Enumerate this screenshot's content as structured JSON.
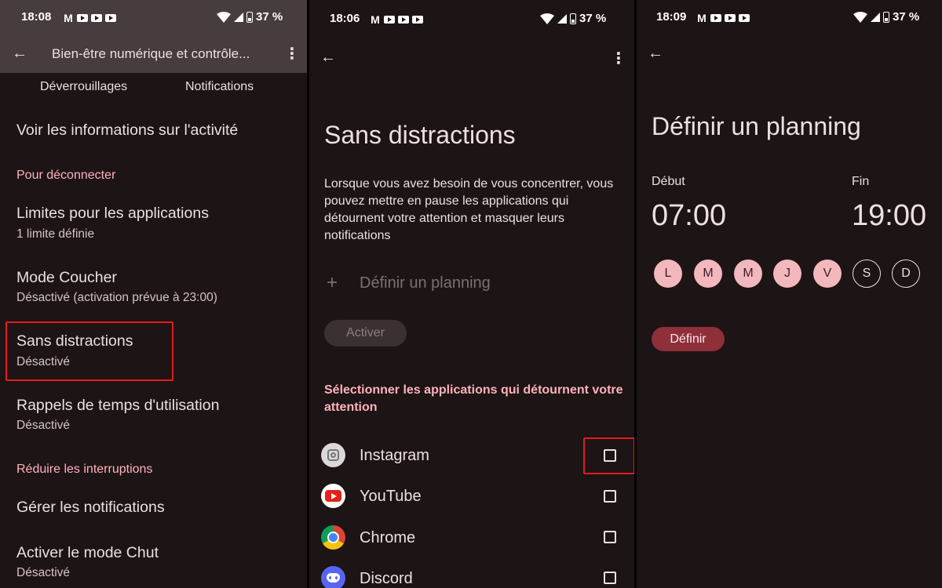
{
  "status_bars": [
    {
      "time": "18:08",
      "battery": "37 %"
    },
    {
      "time": "18:06",
      "battery": "37 %"
    },
    {
      "time": "18:09",
      "battery": "37 %"
    }
  ],
  "panel1": {
    "title": "Bien-être numérique et contrôle...",
    "tabs": [
      "Déverrouillages",
      "Notifications"
    ],
    "view_activity": "Voir les informations sur l'activité",
    "section_disconnect": "Pour déconnecter",
    "items": [
      {
        "title": "Limites pour les applications",
        "subtitle": "1 limite définie"
      },
      {
        "title": "Mode Coucher",
        "subtitle": "Désactivé (activation prévue à 23:00)"
      },
      {
        "title": "Sans distractions",
        "subtitle": "Désactivé"
      },
      {
        "title": "Rappels de temps d'utilisation",
        "subtitle": "Désactivé"
      }
    ],
    "section_interruptions": "Réduire les interruptions",
    "manage_notifications": "Gérer les notifications",
    "hush": {
      "title": "Activer le mode Chut",
      "subtitle": "Désactivé"
    }
  },
  "panel2": {
    "title": "Sans distractions",
    "description": "Lorsque vous avez besoin de vous concentrer, vous pouvez mettre en pause les applications qui détournent votre attention et masquer leurs notifications",
    "schedule_plus": "+",
    "schedule_label": "Définir un planning",
    "activate_button": "Activer",
    "select_heading": "Sélectionner les applications qui détournent votre attention",
    "apps": [
      "Instagram",
      "YouTube",
      "Chrome",
      "Discord"
    ]
  },
  "panel3": {
    "title": "Définir un planning",
    "start_label": "Début",
    "start_time": "07:00",
    "end_label": "Fin",
    "end_time": "19:00",
    "days": [
      "L",
      "M",
      "M",
      "J",
      "V",
      "S",
      "D"
    ],
    "days_selected": [
      true,
      true,
      true,
      true,
      true,
      false,
      false
    ],
    "define_button": "Définir"
  },
  "colors": {
    "background": "#1d1415",
    "accent_pink": "#ffb2bb",
    "highlight_red": "#e41c1c",
    "button_red": "#8f2f3a"
  },
  "icons": [
    "back-arrow-icon",
    "more-vert-icon",
    "wifi-icon",
    "signal-icon",
    "battery-icon",
    "gmail-icon",
    "youtube-icon",
    "plus-icon",
    "checkbox-icon"
  ]
}
